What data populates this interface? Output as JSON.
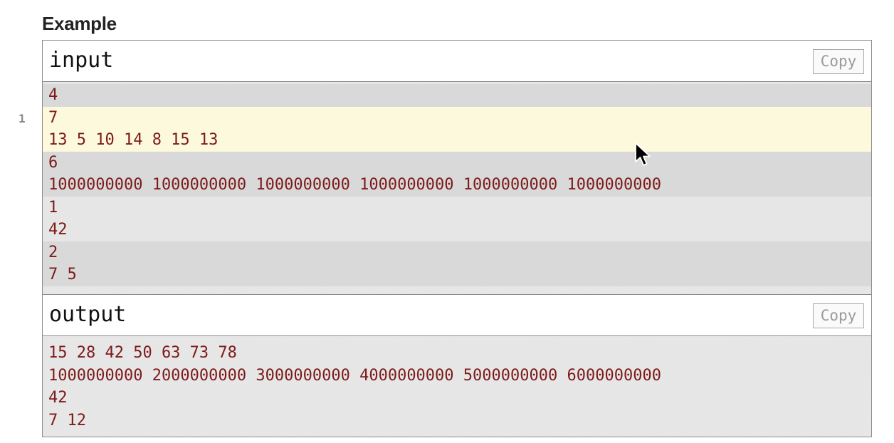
{
  "section": {
    "title": "Example"
  },
  "gutter": {
    "highlight_index": "1"
  },
  "input": {
    "label": "input",
    "copy_label": "Copy",
    "groups": [
      {
        "lines": [
          "4"
        ]
      },
      {
        "lines": [
          "7",
          "13 5 10 14 8 15 13"
        ]
      },
      {
        "lines": [
          "6",
          "1000000000 1000000000 1000000000 1000000000 1000000000 1000000000"
        ]
      },
      {
        "lines": [
          "1",
          "42"
        ]
      },
      {
        "lines": [
          "2",
          "7 5"
        ]
      }
    ]
  },
  "output": {
    "label": "output",
    "copy_label": "Copy",
    "lines": [
      "15 28 42 50 63 73 78",
      "1000000000 2000000000 3000000000 4000000000 5000000000 6000000000",
      "42",
      "7 12"
    ]
  },
  "colors": {
    "code_text": "#7d1a1a",
    "highlight_row": "#fdf9dc"
  },
  "icons": {
    "cursor": "mouse-pointer-icon"
  }
}
